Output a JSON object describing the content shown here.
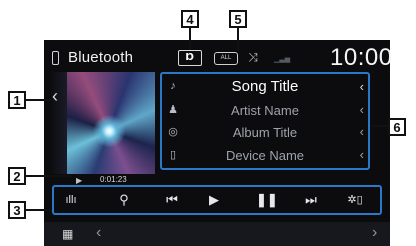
{
  "header": {
    "source_label": "Bluetooth",
    "dolby_icon": "dolby-audio-icon",
    "repeat_icon_text": "ALL",
    "shuffle_icon": "shuffle-icon",
    "clock": "10:00"
  },
  "track": {
    "song_title": "Song Title",
    "artist_name": "Artist Name",
    "album_title": "Album Title",
    "device_name": "Device Name",
    "elapsed": "0:01:23"
  },
  "callouts": {
    "c1": "1",
    "c2": "2",
    "c3": "3",
    "c4": "4",
    "c5": "5",
    "c6": "6"
  },
  "colors": {
    "highlight_border": "#2c78c8",
    "screen_bg": "#0c0c0f",
    "callout_border": "#111111"
  }
}
